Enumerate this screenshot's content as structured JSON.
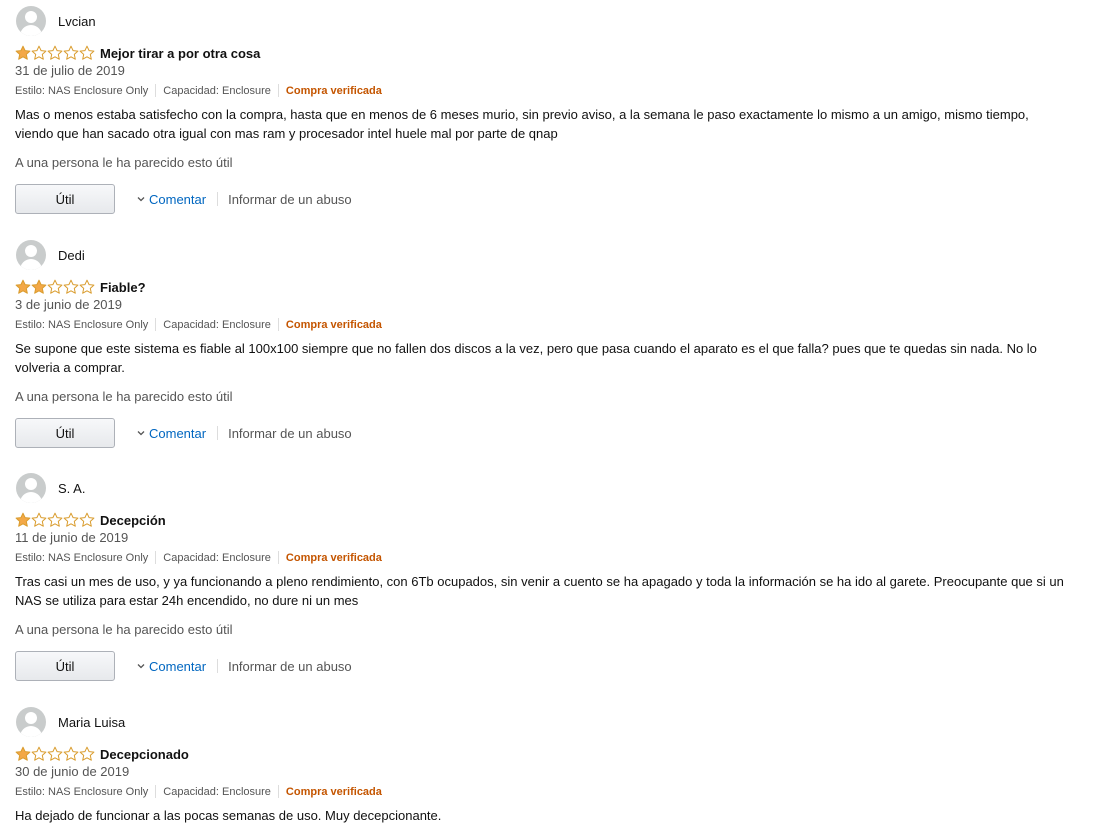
{
  "colors": {
    "star_filled": "#f3a847",
    "star_outline": "#d99c2e",
    "link": "#0066c0",
    "verified": "#c45500",
    "avatar_bg": "#c9cccc"
  },
  "icons": {
    "avatar": "default-avatar-icon",
    "star_filled": "star-filled-icon",
    "star_empty": "star-empty-icon",
    "comment_chevron": "chevron-down-icon"
  },
  "reviews": [
    {
      "author": "Lvcian",
      "rating": 1,
      "title": "Mejor tirar a por otra cosa",
      "date": "31 de julio de 2019",
      "style": "Estilo: NAS Enclosure Only",
      "capacity": "Capacidad: Enclosure",
      "verified": "Compra verificada",
      "body": "Mas o menos estaba satisfecho con la compra, hasta que en menos de 6 meses murio, sin previo aviso, a la semana le paso exactamente lo mismo a un amigo, mismo tiempo, viendo que han sacado otra igual con mas ram y procesador intel huele mal por parte de qnap",
      "helpful_text": "A una persona le ha parecido esto útil",
      "helpful_button": "Útil",
      "comment_label": "Comentar",
      "report_label": "Informar de un abuso"
    },
    {
      "author": "Dedi",
      "rating": 2,
      "title": "Fiable?",
      "date": "3 de junio de 2019",
      "style": "Estilo: NAS Enclosure Only",
      "capacity": "Capacidad: Enclosure",
      "verified": "Compra verificada",
      "body": "Se supone que este sistema es fiable al 100x100 siempre que no fallen dos discos a la vez, pero que pasa cuando el aparato es el que falla? pues que te quedas sin nada. No lo volveria a comprar.",
      "helpful_text": "A una persona le ha parecido esto útil",
      "helpful_button": "Útil",
      "comment_label": "Comentar",
      "report_label": "Informar de un abuso"
    },
    {
      "author": "S. A.",
      "rating": 1,
      "title": "Decepción",
      "date": "11 de junio de 2019",
      "style": "Estilo: NAS Enclosure Only",
      "capacity": "Capacidad: Enclosure",
      "verified": "Compra verificada",
      "body": "Tras casi un mes de uso, y ya funcionando a pleno rendimiento, con 6Tb ocupados, sin venir a cuento se ha apagado y toda la información se ha ido al garete. Preocupante que si un NAS se utiliza para estar 24h encendido, no dure ni un mes",
      "helpful_text": "A una persona le ha parecido esto útil",
      "helpful_button": "Útil",
      "comment_label": "Comentar",
      "report_label": "Informar de un abuso"
    },
    {
      "author": "Maria Luisa",
      "rating": 1,
      "title": "Decepcionado",
      "date": "30 de junio de 2019",
      "style": "Estilo: NAS Enclosure Only",
      "capacity": "Capacidad: Enclosure",
      "verified": "Compra verificada",
      "body": "Ha dejado de funcionar a las pocas semanas de uso. Muy decepcionante."
    }
  ]
}
